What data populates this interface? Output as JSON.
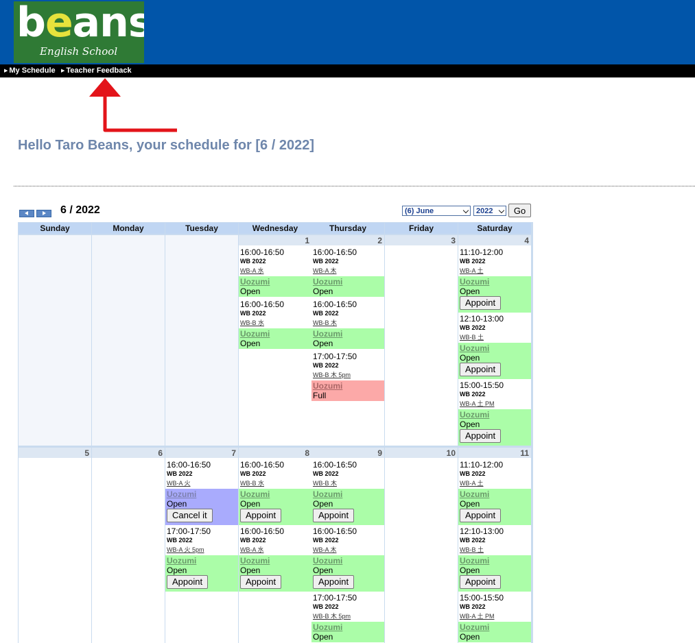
{
  "colors": {
    "header_bg": "#0155a9",
    "status_open": "#abfda8",
    "status_full": "#fca9a8",
    "status_booked": "#a9abfd",
    "greeting": "#6e86ab"
  },
  "logo": {
    "text_b": "b",
    "text_e": "e",
    "text_rest": "ans",
    "subtitle": "English School"
  },
  "nav": {
    "my_schedule": "My Schedule",
    "teacher_feedback": "Teacher Feedback"
  },
  "greeting": "Hello Taro Beans, your schedule for [6 / 2022]",
  "calendar": {
    "month_label": "6 / 2022",
    "month_select": "(6) June",
    "year_select": "2022",
    "go_label": "Go",
    "days": [
      "Sunday",
      "Monday",
      "Tuesday",
      "Wednesday",
      "Thursday",
      "Friday",
      "Saturday"
    ],
    "weeks": [
      {
        "dates": [
          "",
          "",
          "",
          "1",
          "2",
          "3",
          "4"
        ],
        "slots": [
          [],
          [],
          [],
          [
            {
              "time": "16:00-16:50",
              "course": "WB 2022",
              "class": "WB-A 水",
              "teacher": "Uozumi",
              "state": "Open",
              "status": "open",
              "button": ""
            },
            {
              "time": "16:00-16:50",
              "course": "WB 2022",
              "class": "WB-B 水",
              "teacher": "Uozumi",
              "state": "Open",
              "status": "open",
              "button": ""
            }
          ],
          [
            {
              "time": "16:00-16:50",
              "course": "WB 2022",
              "class": "WB-A 木",
              "teacher": "Uozumi",
              "state": "Open",
              "status": "open",
              "button": ""
            },
            {
              "time": "16:00-16:50",
              "course": "WB 2022",
              "class": "WB-B 木",
              "teacher": "Uozumi",
              "state": "Open",
              "status": "open",
              "button": ""
            },
            {
              "time": "17:00-17:50",
              "course": "WB 2022",
              "class": "WB-B 木 5pm",
              "teacher": "Uozumi",
              "state": "Full",
              "status": "full",
              "button": ""
            }
          ],
          [],
          [
            {
              "time": "11:10-12:00",
              "course": "WB 2022",
              "class": "WB-A 土",
              "teacher": "Uozumi",
              "state": "Open",
              "status": "open",
              "button": "Appoint"
            },
            {
              "time": "12:10-13:00",
              "course": "WB 2022",
              "class": "WB-B 土",
              "teacher": "Uozumi",
              "state": "Open",
              "status": "open",
              "button": "Appoint"
            },
            {
              "time": "15:00-15:50",
              "course": "WB 2022",
              "class": "WB-A 土 PM",
              "teacher": "Uozumi",
              "state": "Open",
              "status": "open",
              "button": "Appoint"
            }
          ]
        ]
      },
      {
        "dates": [
          "5",
          "6",
          "7",
          "8",
          "9",
          "10",
          "11"
        ],
        "slots": [
          [],
          [],
          [
            {
              "time": "16:00-16:50",
              "course": "WB 2022",
              "class": "WB-A 火",
              "teacher": "Uozumi",
              "state": "Open",
              "status": "booked",
              "button": "Cancel it"
            },
            {
              "time": "17:00-17:50",
              "course": "WB 2022",
              "class": "WB-A 火 5pm",
              "teacher": "Uozumi",
              "state": "Open",
              "status": "open",
              "button": "Appoint"
            }
          ],
          [
            {
              "time": "16:00-16:50",
              "course": "WB 2022",
              "class": "WB-B 水",
              "teacher": "Uozumi",
              "state": "Open",
              "status": "open",
              "button": "Appoint"
            },
            {
              "time": "16:00-16:50",
              "course": "WB 2022",
              "class": "WB-A 水",
              "teacher": "Uozumi",
              "state": "Open",
              "status": "open",
              "button": "Appoint"
            }
          ],
          [
            {
              "time": "16:00-16:50",
              "course": "WB 2022",
              "class": "WB-B 木",
              "teacher": "Uozumi",
              "state": "Open",
              "status": "open",
              "button": "Appoint"
            },
            {
              "time": "16:00-16:50",
              "course": "WB 2022",
              "class": "WB-A 木",
              "teacher": "Uozumi",
              "state": "Open",
              "status": "open",
              "button": "Appoint"
            },
            {
              "time": "17:00-17:50",
              "course": "WB 2022",
              "class": "WB-B 木 5pm",
              "teacher": "Uozumi",
              "state": "Open",
              "status": "open",
              "button": ""
            }
          ],
          [],
          [
            {
              "time": "11:10-12:00",
              "course": "WB 2022",
              "class": "WB-A 土",
              "teacher": "Uozumi",
              "state": "Open",
              "status": "open",
              "button": "Appoint"
            },
            {
              "time": "12:10-13:00",
              "course": "WB 2022",
              "class": "WB-B 土",
              "teacher": "Uozumi",
              "state": "Open",
              "status": "open",
              "button": "Appoint"
            },
            {
              "time": "15:00-15:50",
              "course": "WB 2022",
              "class": "WB-A 土 PM",
              "teacher": "Uozumi",
              "state": "Open",
              "status": "open",
              "button": ""
            }
          ]
        ]
      }
    ]
  }
}
